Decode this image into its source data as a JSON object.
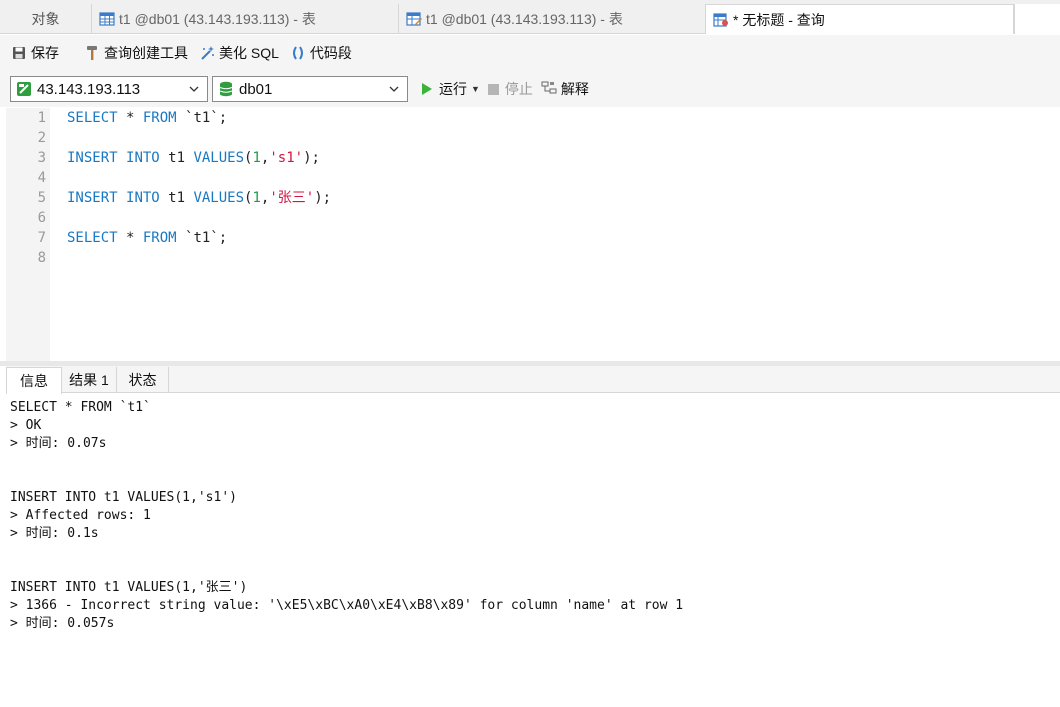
{
  "tabs": {
    "objects": "对象",
    "table_tab_1": "t1 @db01 (43.143.193.113) - 表",
    "table_tab_2": "t1 @db01 (43.143.193.113) - 表",
    "query_tab": "* 无标题 - 查询"
  },
  "toolbar": {
    "save": "保存",
    "query_builder": "查询创建工具",
    "beautify_sql": "美化 SQL",
    "snippet": "代码段"
  },
  "connbar": {
    "connection": "43.143.193.113",
    "database": "db01",
    "run": "运行",
    "stop": "停止",
    "explain": "解释"
  },
  "editor": {
    "line_numbers": [
      "1",
      "2",
      "3",
      "4",
      "5",
      "6",
      "7",
      "8"
    ],
    "lines": [
      {
        "kw1": "SELECT",
        "mid": " * ",
        "kw2": "FROM",
        "rest": " `t1`;"
      },
      {},
      {
        "kw1": "INSERT",
        "sp": " ",
        "kw2": "INTO",
        "mid": " t1 ",
        "kw3": "VALUES",
        "open": "(",
        "num": "1",
        "comma": ",",
        "str": "'s1'",
        "close": ");"
      },
      {},
      {
        "kw1": "INSERT",
        "sp": " ",
        "kw2": "INTO",
        "mid": " t1 ",
        "kw3": "VALUES",
        "open": "(",
        "num": "1",
        "comma": ",",
        "str": "'张三'",
        "close": ");"
      },
      {},
      {
        "kw1": "SELECT",
        "mid": " * ",
        "kw2": "FROM",
        "rest": " `t1`;"
      },
      {}
    ]
  },
  "result_tabs": {
    "info": "信息",
    "result1": "结果 1",
    "status": "状态"
  },
  "messages": [
    "SELECT * FROM `t1`",
    "> OK",
    "> 时间: 0.07s",
    "INSERT INTO t1 VALUES(1,'s1')",
    "> Affected rows: 1",
    "> 时间: 0.1s",
    "INSERT INTO t1 VALUES(1,'张三')",
    "> 1366 - Incorrect string value: '\\xE5\\xBC\\xA0\\xE4\\xB8\\x89' for column 'name' at row 1",
    "> 时间: 0.057s"
  ],
  "colors": {
    "keyword": "#1a78c2",
    "number": "#1a9b4b",
    "string": "#d0173f",
    "run_green": "#3bb33b"
  }
}
